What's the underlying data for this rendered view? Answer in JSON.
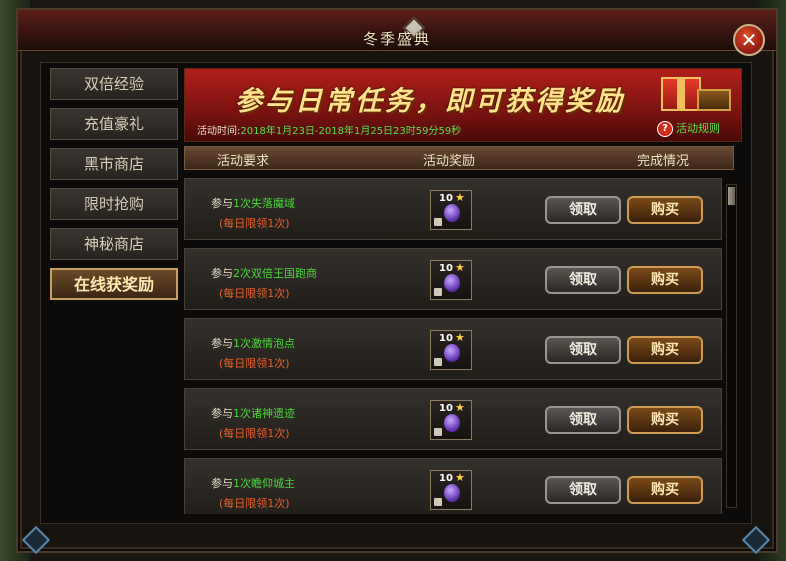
{
  "window": {
    "title": "冬季盛典",
    "close_label": "✕"
  },
  "sidebar": {
    "items": [
      {
        "label": "双倍经验",
        "active": false
      },
      {
        "label": "充值豪礼",
        "active": false
      },
      {
        "label": "黑市商店",
        "active": false
      },
      {
        "label": "限时抢购",
        "active": false
      },
      {
        "label": "神秘商店",
        "active": false
      },
      {
        "label": "在线获奖励",
        "active": true
      }
    ]
  },
  "banner": {
    "title": "参与日常任务，即可获得奖励",
    "time_label": "活动时间:",
    "time_value": "2018年1月23日-2018年1月25日23时59分59秒",
    "rules_label": "活动规则",
    "rules_icon": "?"
  },
  "table": {
    "headers": [
      "活动要求",
      "活动奖励",
      "完成情况"
    ],
    "rows": [
      {
        "prefix": "参与",
        "highlight": "1次失落魔域",
        "limit": "(每日限领1次)",
        "reward_count": "10",
        "reward_star": "★",
        "claim": "领取",
        "buy": "购买"
      },
      {
        "prefix": "参与",
        "highlight": "2次双倍王国跑商",
        "limit": "(每日限领1次)",
        "reward_count": "10",
        "reward_star": "★",
        "claim": "领取",
        "buy": "购买"
      },
      {
        "prefix": "参与",
        "highlight": "1次激情泡点",
        "limit": "(每日限领1次)",
        "reward_count": "10",
        "reward_star": "★",
        "claim": "领取",
        "buy": "购买"
      },
      {
        "prefix": "参与",
        "highlight": "1次诸神遗迹",
        "limit": "(每日限领1次)",
        "reward_count": "10",
        "reward_star": "★",
        "claim": "领取",
        "buy": "购买"
      },
      {
        "prefix": "参与",
        "highlight": "1次瞻仰城主",
        "limit": "(每日限领1次)",
        "reward_count": "10",
        "reward_star": "★",
        "claim": "领取",
        "buy": "购买"
      }
    ]
  },
  "colors": {
    "accent": "#c8a060",
    "highlight_text": "#4ad83a",
    "limit_text": "#e8602a",
    "banner_red": "#b0201a"
  },
  "icons": {
    "close": "close-icon",
    "rules": "question-icon",
    "reward": "reward-orb-icon",
    "lock": "lock-icon"
  }
}
